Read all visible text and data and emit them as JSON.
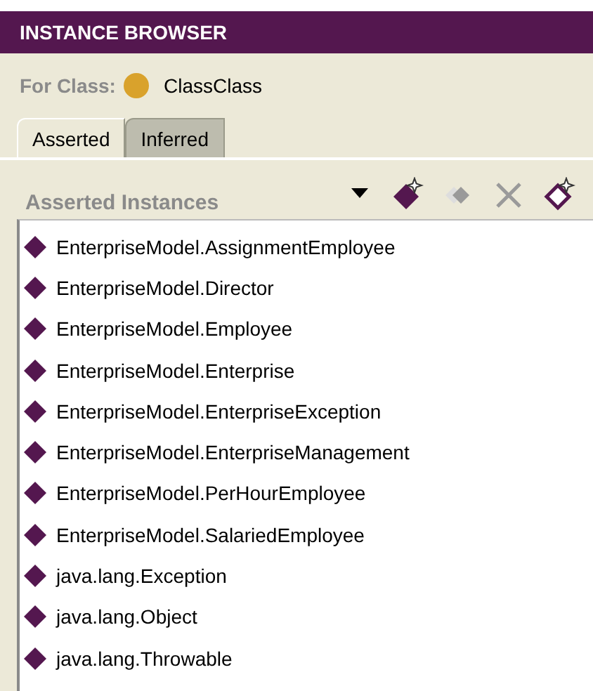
{
  "panel": {
    "title": "INSTANCE BROWSER"
  },
  "class_selector": {
    "label": "For Class:",
    "value": "ClassClass"
  },
  "tabs": [
    {
      "label": "Asserted",
      "selected": true
    },
    {
      "label": "Inferred",
      "selected": false
    }
  ],
  "list_header": {
    "title": "Asserted Instances"
  },
  "toolbar": [
    {
      "kind": "menu",
      "disabled": false
    },
    {
      "kind": "create",
      "disabled": false
    },
    {
      "kind": "copy",
      "disabled": true
    },
    {
      "kind": "delete",
      "disabled": true
    },
    {
      "kind": "create-outline",
      "disabled": false
    }
  ],
  "instances": [
    {
      "label": "EnterpriseModel.AssignmentEmployee"
    },
    {
      "label": "EnterpriseModel.Director"
    },
    {
      "label": "EnterpriseModel.Employee"
    },
    {
      "label": "EnterpriseModel.Enterprise"
    },
    {
      "label": "EnterpriseModel.EnterpriseException"
    },
    {
      "label": "EnterpriseModel.EnterpriseManagement"
    },
    {
      "label": "EnterpriseModel.PerHourEmployee"
    },
    {
      "label": "EnterpriseModel.SalariedEmployee"
    },
    {
      "label": "java.lang.Exception"
    },
    {
      "label": "java.lang.Object"
    },
    {
      "label": "java.lang.Throwable"
    }
  ]
}
